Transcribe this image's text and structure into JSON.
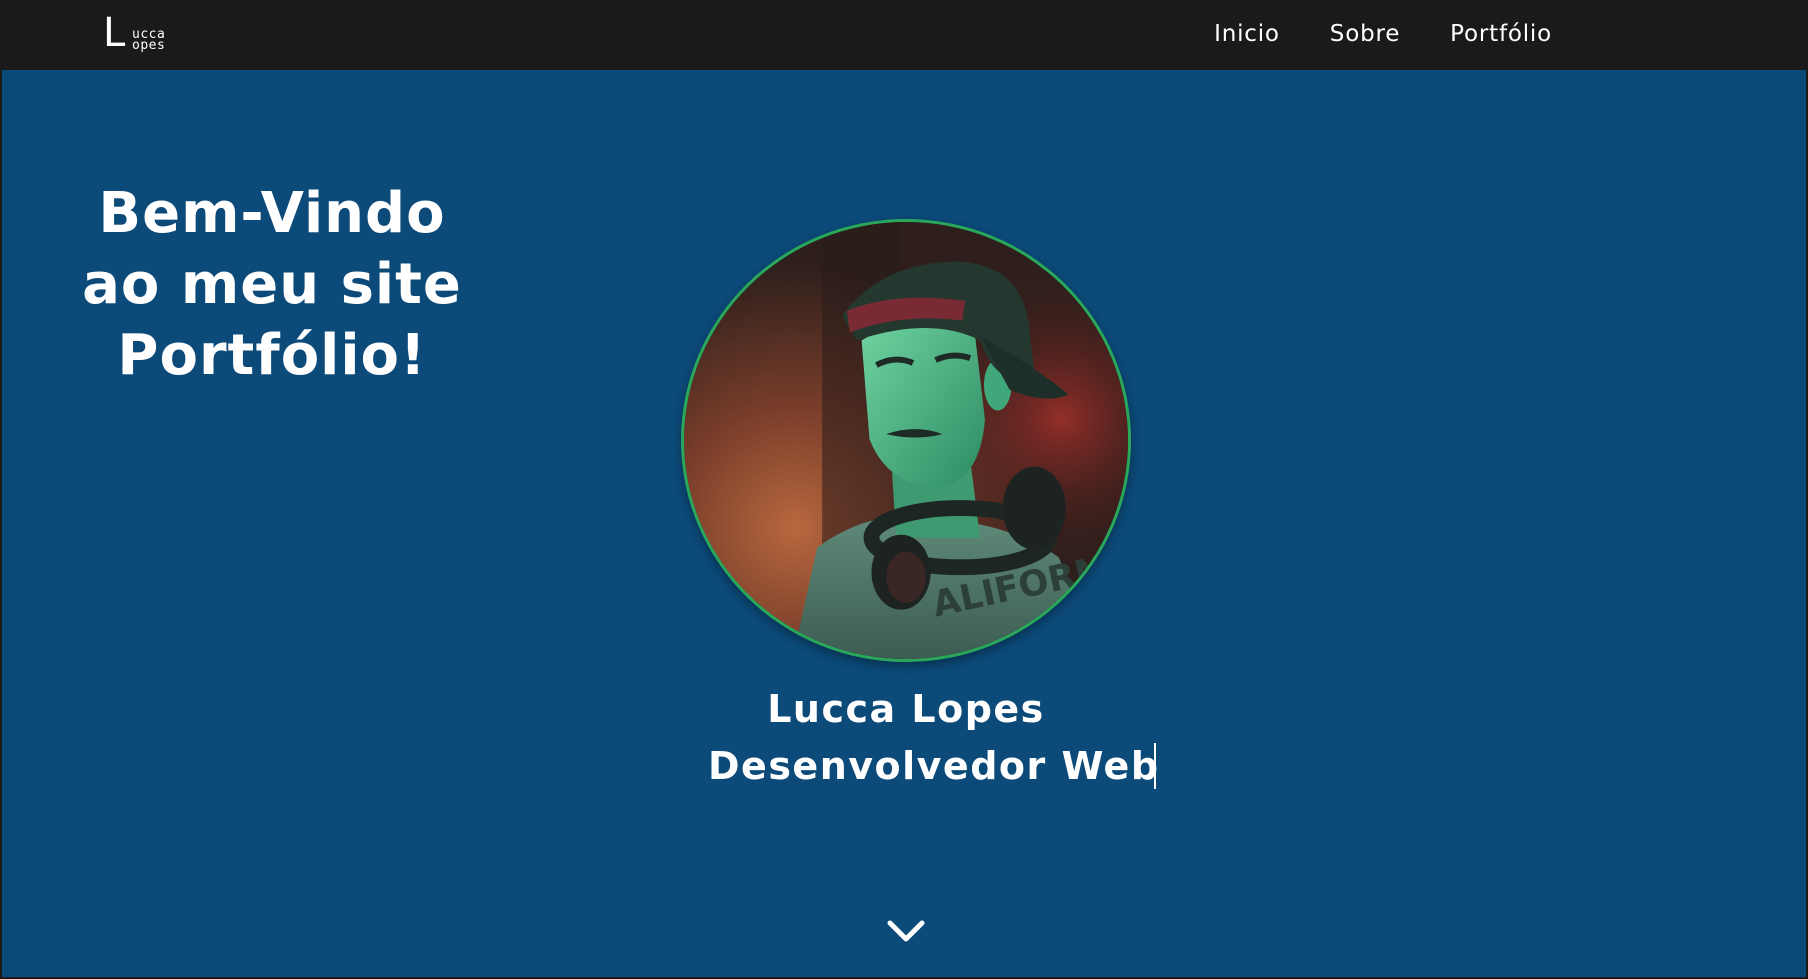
{
  "navbar": {
    "logo": {
      "initial": "L",
      "line1": "ucca",
      "line2": "opes"
    },
    "links": [
      {
        "label": "Inicio"
      },
      {
        "label": "Sobre"
      },
      {
        "label": "Portfólio"
      }
    ]
  },
  "hero": {
    "welcome_line1": "Bem-Vindo",
    "welcome_line2": "ao meu site",
    "welcome_line3": "Portfólio!",
    "name": "Lucca Lopes",
    "role": "Desenvolvedor Web",
    "scroll_icon": "chevron-down-icon"
  },
  "colors": {
    "navbar_bg": "#1a1a1a",
    "hero_bg": "#0c4a79",
    "avatar_border": "#2aa85a",
    "text": "#ffffff"
  }
}
